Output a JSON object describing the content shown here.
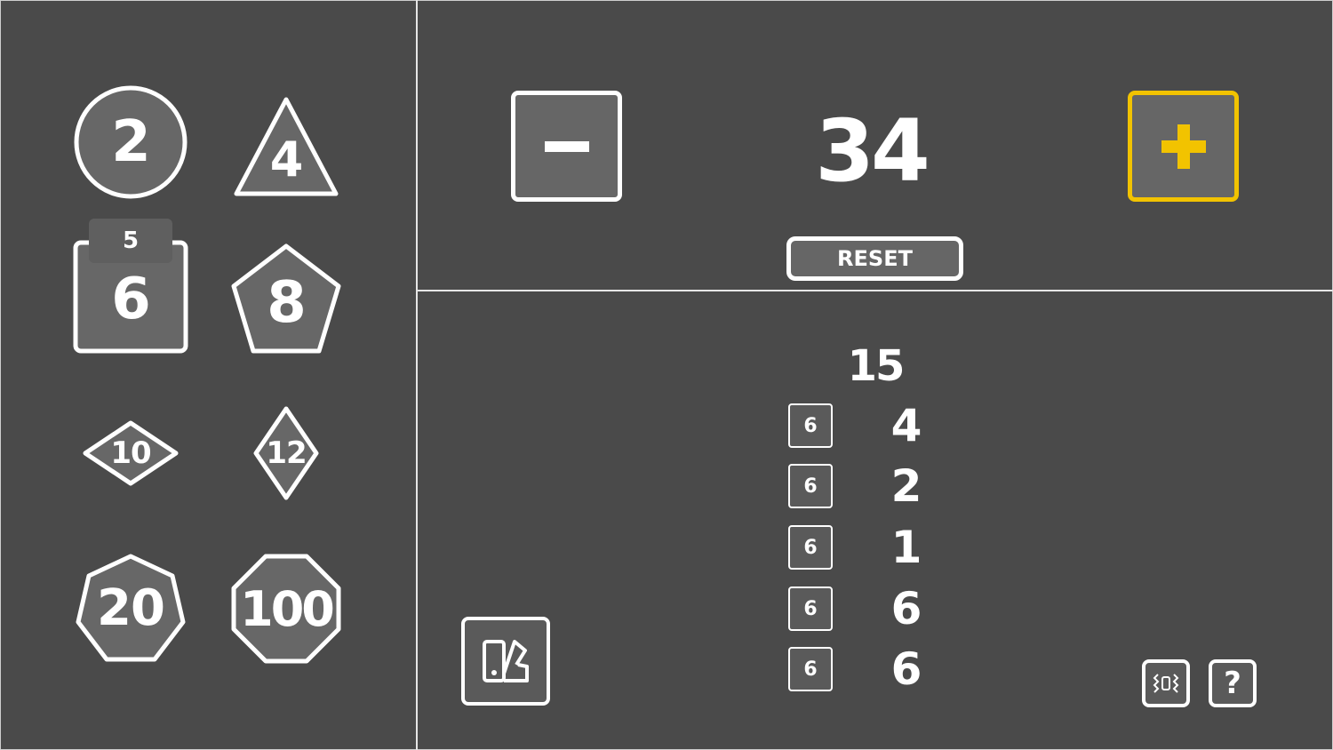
{
  "dice": [
    {
      "id": "d2",
      "label": "2",
      "shape": "circle"
    },
    {
      "id": "d4",
      "label": "4",
      "shape": "triangle"
    },
    {
      "id": "d6",
      "label": "6",
      "shape": "square",
      "count": "5"
    },
    {
      "id": "d8",
      "label": "8",
      "shape": "pentagon"
    },
    {
      "id": "d10",
      "label": "10",
      "shape": "wide-diamond"
    },
    {
      "id": "d12",
      "label": "12",
      "shape": "tall-diamond"
    },
    {
      "id": "d20",
      "label": "20",
      "shape": "heptagon"
    },
    {
      "id": "d100",
      "label": "100",
      "shape": "octagon"
    }
  ],
  "modifier": {
    "value": "34",
    "minus_icon": "minus-icon",
    "plus_icon": "plus-icon"
  },
  "reset_label": "RESET",
  "result": {
    "total": "15",
    "rolls": [
      {
        "die": "6",
        "value": "4"
      },
      {
        "die": "6",
        "value": "2"
      },
      {
        "die": "6",
        "value": "1"
      },
      {
        "die": "6",
        "value": "6"
      },
      {
        "die": "6",
        "value": "6"
      }
    ]
  },
  "bottom": {
    "theme_icon": "palette-icon",
    "vibrate_icon": "vibration-icon",
    "help_label": "?"
  },
  "colors": {
    "background": "#4a4a4a",
    "die_fill": "#676767",
    "stroke": "#ffffff",
    "accent": "#f2c300"
  }
}
